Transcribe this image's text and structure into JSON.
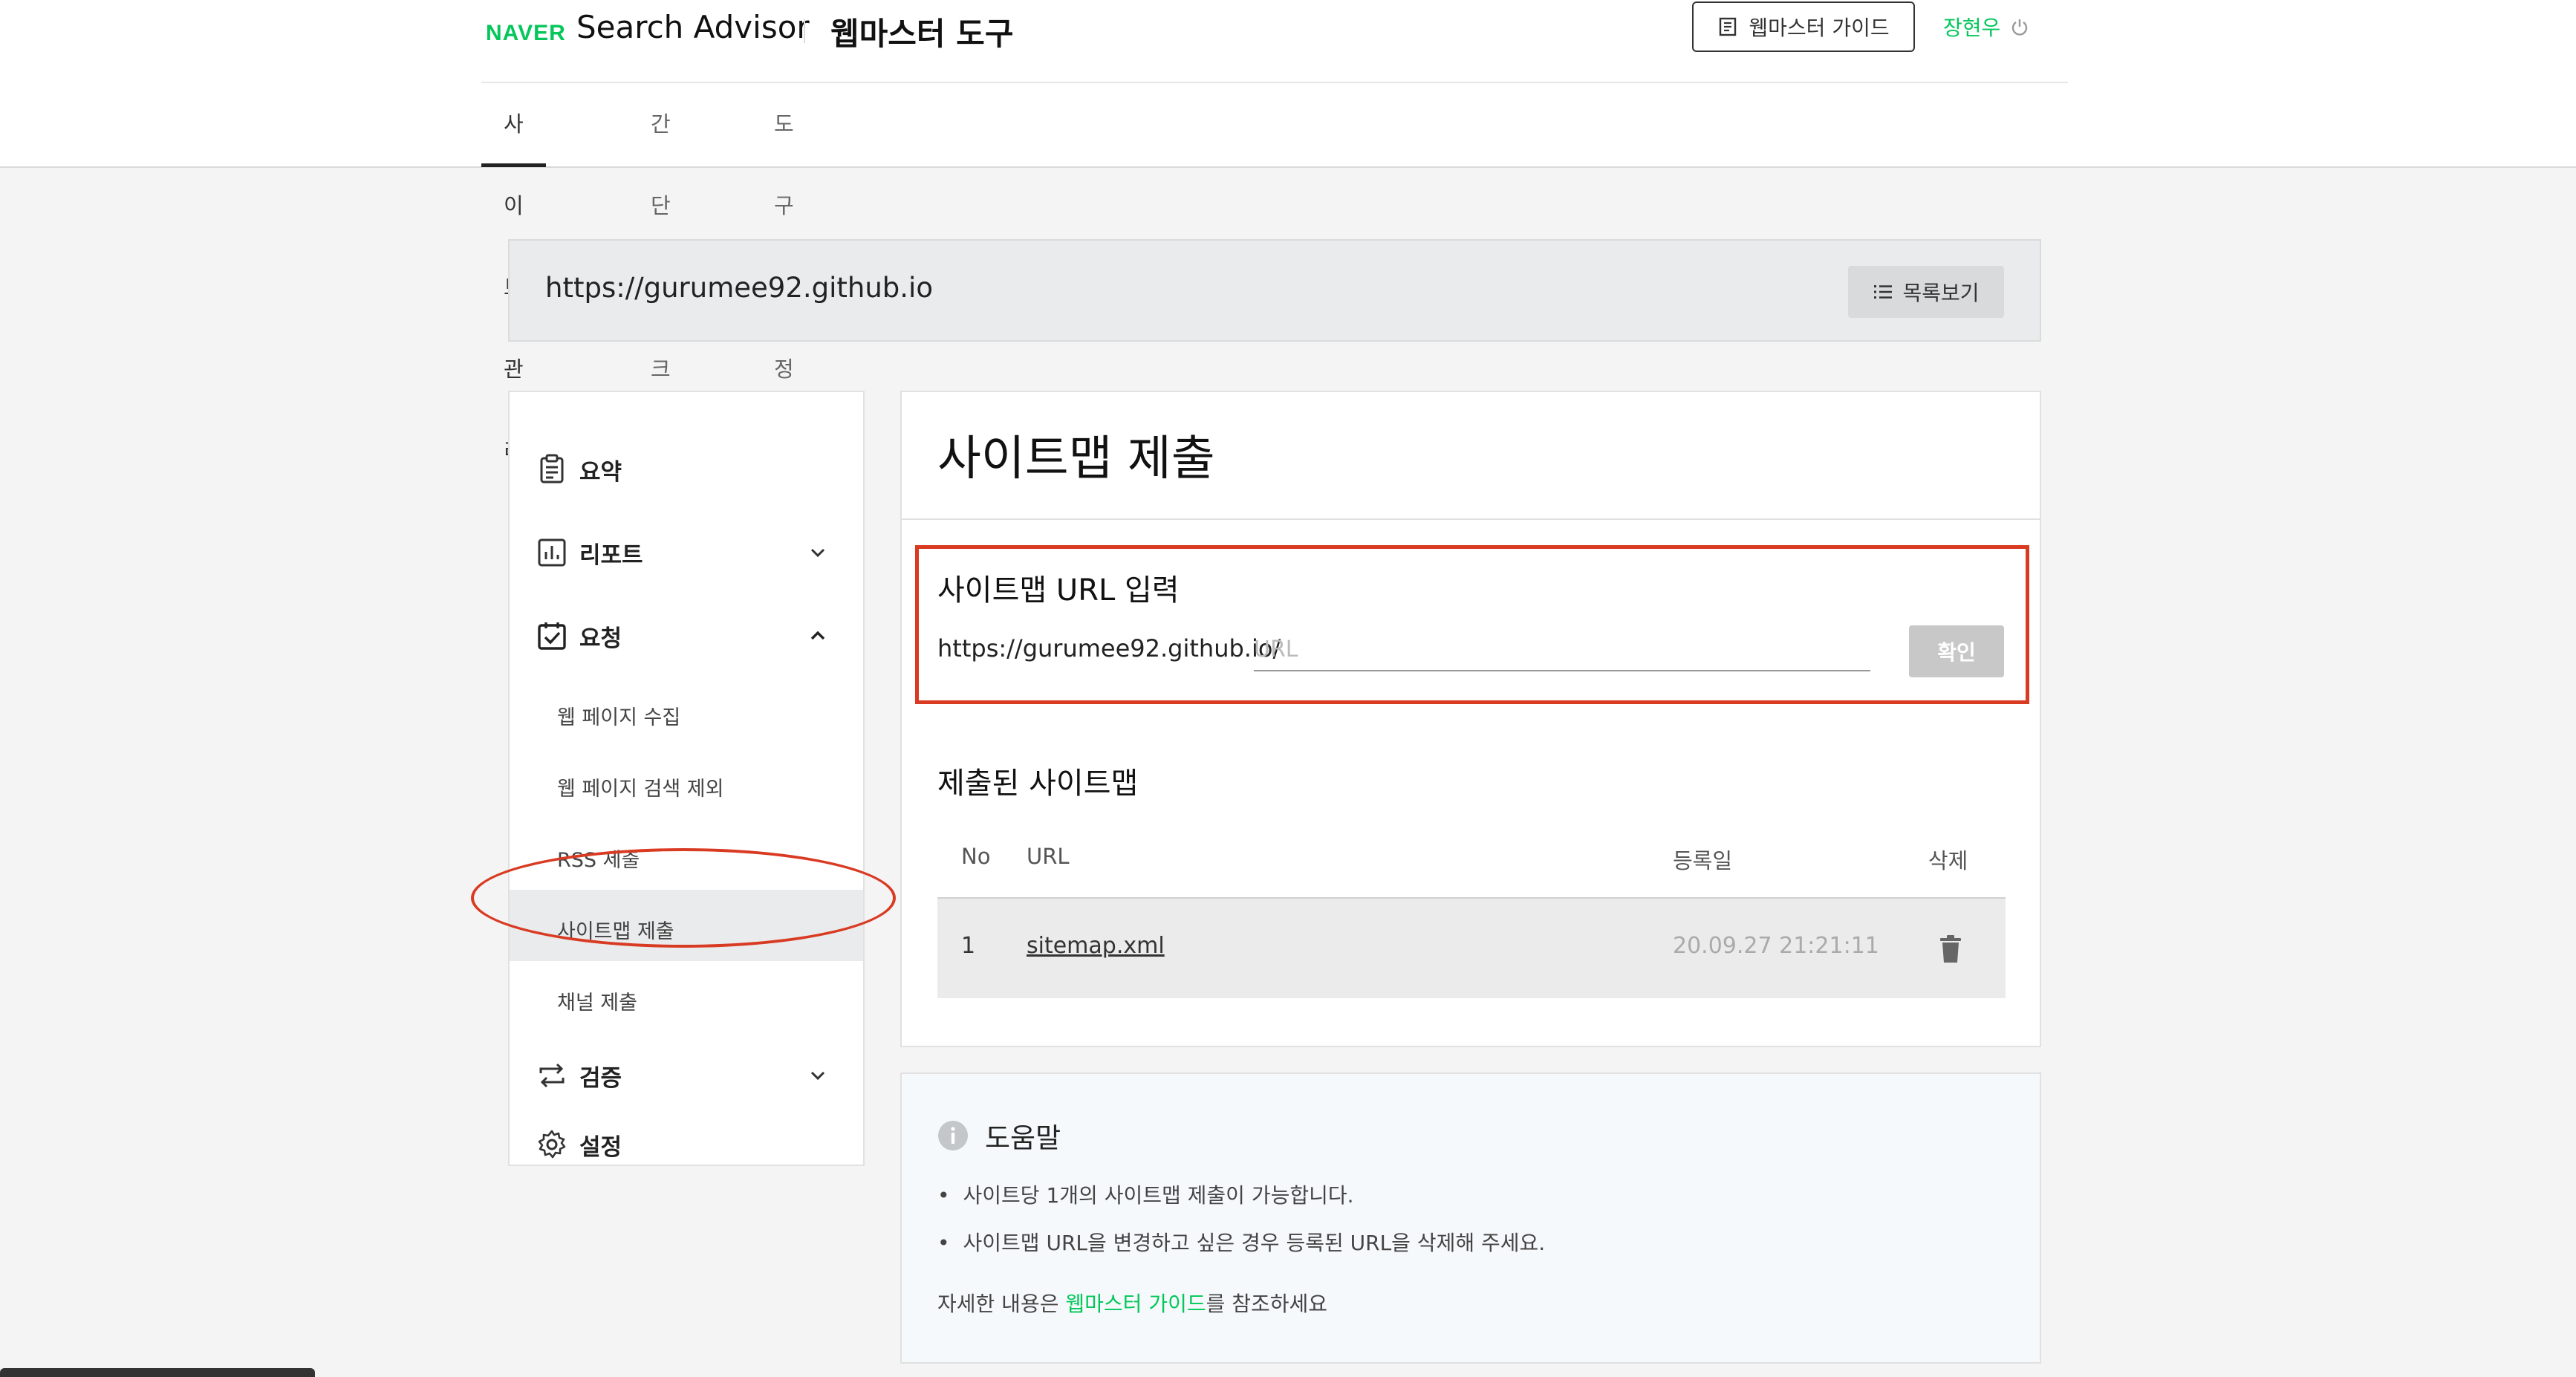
{
  "header": {
    "logo": "NAVER",
    "product": "Search Advisor",
    "tool": "웹마스터 도구",
    "guide_button": "웹마스터 가이드",
    "user_name": "장현우",
    "brand_color": "#03c75a"
  },
  "tabs": [
    {
      "label": "사이트 관리",
      "active": true
    },
    {
      "label": "간단체크",
      "active": false
    },
    {
      "label": "도구 설정",
      "active": false
    }
  ],
  "site": {
    "url": "https://gurumee92.github.io",
    "list_button": "목록보기"
  },
  "sidebar": {
    "items": [
      {
        "label": "요약",
        "icon": "clipboard-icon"
      },
      {
        "label": "리포트",
        "icon": "bar-chart-icon",
        "expanded": false
      },
      {
        "label": "요청",
        "icon": "calendar-check-icon",
        "expanded": true
      },
      {
        "label": "검증",
        "icon": "repeat-icon",
        "expanded": false
      },
      {
        "label": "설정",
        "icon": "gear-icon"
      }
    ],
    "sub_items": [
      {
        "label": "웹 페이지 수집"
      },
      {
        "label": "웹 페이지 검색 제외"
      },
      {
        "label": "RSS 제출"
      },
      {
        "label": "사이트맵 제출",
        "active": true
      },
      {
        "label": "채널 제출"
      }
    ]
  },
  "main": {
    "title": "사이트맵 제출",
    "input_section_title": "사이트맵 URL 입력",
    "url_prefix": "https://gurumee92.github.io/",
    "url_placeholder": "URL",
    "confirm_button": "확인",
    "submitted_title": "제출된 사이트맵",
    "table_headers": [
      "No",
      "URL",
      "등록일",
      "삭제"
    ],
    "rows": [
      {
        "no": "1",
        "url": "sitemap.xml",
        "date": "20.09.27 21:21:11"
      }
    ]
  },
  "help": {
    "title": "도움말",
    "items": [
      "사이트당 1개의 사이트맵 제출이 가능합니다.",
      "사이트맵 URL을 변경하고 싶은 경우 등록된 URL을 삭제해 주세요."
    ],
    "more_prefix": "자세한 내용은 ",
    "more_link": "웹마스터 가이드",
    "more_suffix": "를 참조하세요"
  },
  "annotation_color": "#d93a22"
}
